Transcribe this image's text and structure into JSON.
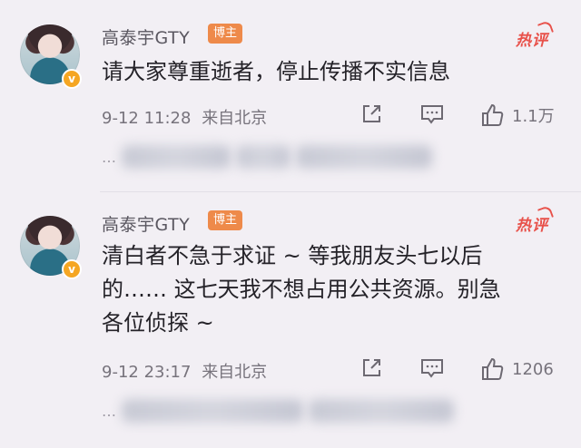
{
  "comments": [
    {
      "author": "高泰宇GTY",
      "author_tag": "博主",
      "verified_badge": "v",
      "hot_label": "热评",
      "text": "请大家尊重逝者，停止传播不实信息",
      "time": "9-12 11:28",
      "location": "来自北京",
      "likes": "1.1万",
      "replies_preview_prefix": "…",
      "icons": {
        "share": "share-icon",
        "reply": "comment-icon",
        "like": "thumbs-up-icon"
      }
    },
    {
      "author": "高泰宇GTY",
      "author_tag": "博主",
      "verified_badge": "v",
      "hot_label": "热评",
      "text": "清白者不急于求证 ~ 等我朋友头七以后\n的…… 这七天我不想占用公共资源。别急\n各位侦探 ~",
      "time": "9-12 23:17",
      "location": "来自北京",
      "likes": "1206",
      "replies_preview_prefix": "…",
      "icons": {
        "share": "share-icon",
        "reply": "comment-icon",
        "like": "thumbs-up-icon"
      }
    }
  ],
  "colors": {
    "background": "#f2eff4",
    "hot": "#e8514a",
    "tag": "#ee8a4a",
    "verified": "#f5a623"
  }
}
